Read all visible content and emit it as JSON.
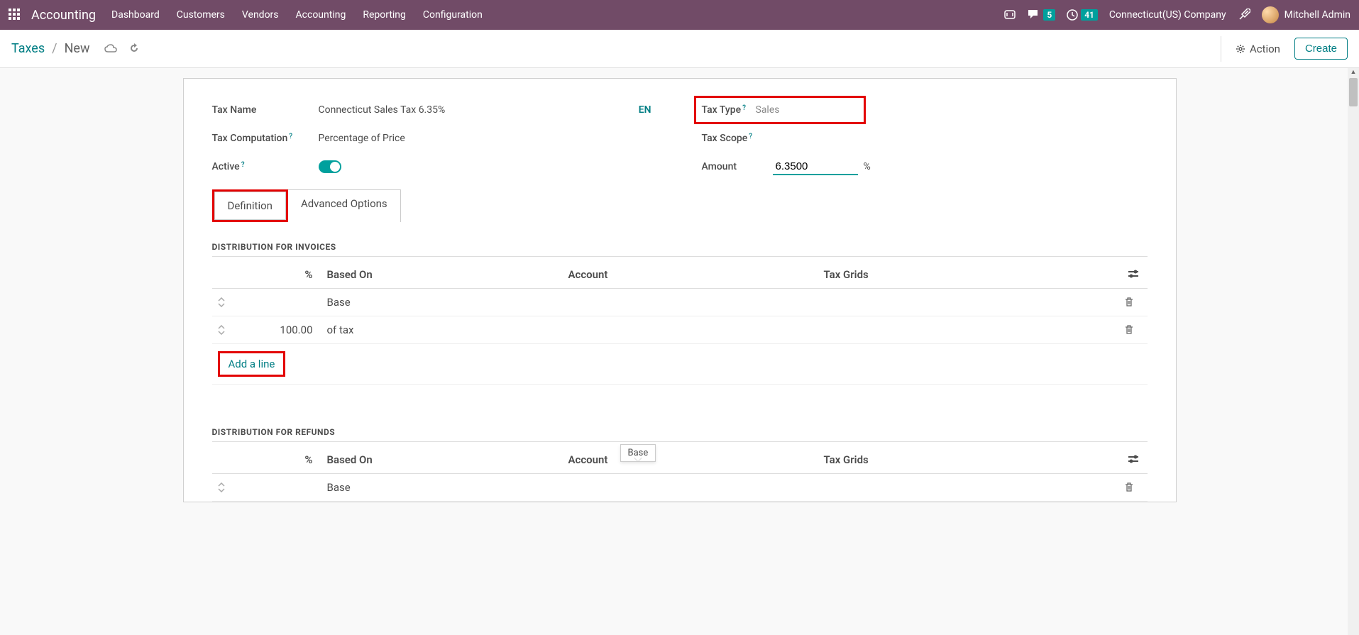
{
  "topnav": {
    "brand": "Accounting",
    "items": [
      "Dashboard",
      "Customers",
      "Vendors",
      "Accounting",
      "Reporting",
      "Configuration"
    ],
    "messages_badge": "5",
    "activities_badge": "41",
    "company": "Connecticut(US) Company",
    "user": "Mitchell Admin"
  },
  "controlbar": {
    "breadcrumb_root": "Taxes",
    "breadcrumb_current": "New",
    "action_label": "Action",
    "create_label": "Create"
  },
  "form": {
    "tax_name_label": "Tax Name",
    "tax_name_value": "Connecticut Sales Tax 6.35%",
    "lang_badge": "EN",
    "tax_computation_label": "Tax Computation",
    "tax_computation_value": "Percentage of Price",
    "active_label": "Active",
    "tax_type_label": "Tax Type",
    "tax_type_value": "Sales",
    "tax_scope_label": "Tax Scope",
    "amount_label": "Amount",
    "amount_value": "6.3500",
    "amount_suffix": "%"
  },
  "tabs": {
    "definition": "Definition",
    "advanced": "Advanced Options"
  },
  "invoices_section": {
    "title": "DISTRIBUTION FOR INVOICES",
    "headers": {
      "pct": "%",
      "basedon": "Based On",
      "account": "Account",
      "taxgrids": "Tax Grids"
    },
    "rows": [
      {
        "pct": "",
        "basedon": "Base"
      },
      {
        "pct": "100.00",
        "basedon": "of tax"
      }
    ],
    "add_line": "Add a line"
  },
  "refunds_section": {
    "title": "DISTRIBUTION FOR REFUNDS",
    "headers": {
      "pct": "%",
      "basedon": "Based On",
      "account": "Account",
      "taxgrids": "Tax Grids"
    },
    "rows": [
      {
        "pct": "",
        "basedon": "Base"
      }
    ]
  },
  "tooltip": {
    "text": "Base"
  }
}
